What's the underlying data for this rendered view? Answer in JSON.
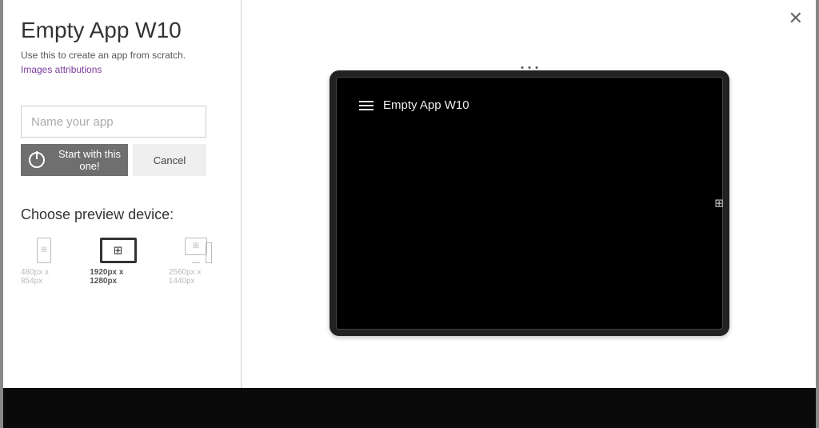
{
  "header": {
    "title": "Empty App W10",
    "subtitle": "Use this to create an app from scratch.",
    "attributions_link": "Images attributions"
  },
  "form": {
    "name_placeholder": "Name your app",
    "start_label": "Start with this one!",
    "cancel_label": "Cancel"
  },
  "devices": {
    "section_label": "Choose preview device:",
    "options": [
      {
        "label": "480px x 854px"
      },
      {
        "label": "1920px x 1280px"
      },
      {
        "label": "2560px x 1440px"
      }
    ],
    "selected_index": 1
  },
  "preview": {
    "app_title": "Empty App W10"
  },
  "close_glyph": "✕"
}
